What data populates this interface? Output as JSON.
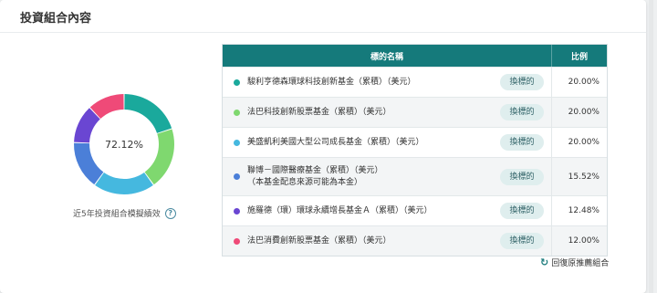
{
  "section_title": "投資組合內容",
  "donut": {
    "center_value": "72.12%",
    "caption": "近5年投資組合模擬績效",
    "help_icon": "help-icon"
  },
  "table": {
    "header_name": "標的名稱",
    "header_ratio": "比例"
  },
  "funds": [
    {
      "name": "駿利亨德森環球科技創新基金（累積）（美元）",
      "note": "",
      "button": "換標的",
      "ratio": "20.00%",
      "percent": 20.0,
      "color": "#1aa99c"
    },
    {
      "name": "法巴科技創新股票基金（累積）（美元）",
      "note": "",
      "button": "換標的",
      "ratio": "20.00%",
      "percent": 20.0,
      "color": "#7fd86f"
    },
    {
      "name": "美盛凱利美國大型公司成長基金（累積）（美元）",
      "note": "",
      "button": "換標的",
      "ratio": "20.00%",
      "percent": 20.0,
      "color": "#45b8df"
    },
    {
      "name": "聯博－國際醫療基金（累積）（美元）",
      "note": "（本基金配息來源可能為本金）",
      "button": "換標的",
      "ratio": "15.52%",
      "percent": 15.52,
      "color": "#4b7fd8"
    },
    {
      "name": "施羅德（環）環球永續增長基金Ａ（累積）（美元）",
      "note": "",
      "button": "換標的",
      "ratio": "12.48%",
      "percent": 12.48,
      "color": "#6a46d2"
    },
    {
      "name": "法巴消費創新股票基金（累積）（美元）",
      "note": "",
      "button": "換標的",
      "ratio": "12.00%",
      "percent": 12.0,
      "color": "#ef4a78"
    }
  ],
  "reset": {
    "label": "回復原推薦組合",
    "icon": "refresh-icon"
  }
}
